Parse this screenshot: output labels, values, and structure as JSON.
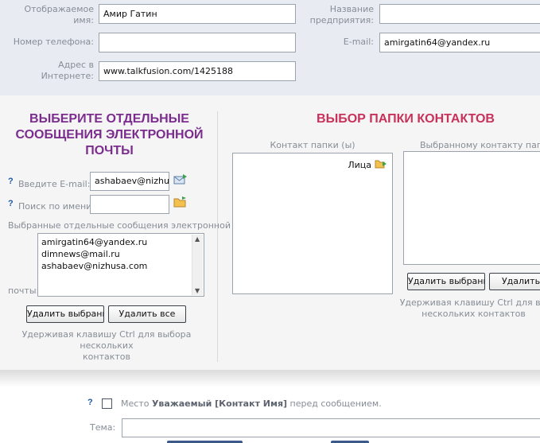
{
  "form": {
    "display_name_label_1": "Отображаемое",
    "display_name_label_2": "имя:",
    "display_name_value": "Амир Гатин",
    "company_label_1": "Название",
    "company_label_2": "предприятия:",
    "company_value": "",
    "phone_label": "Номер телефона:",
    "phone_value": "",
    "email_label": "E-mail:",
    "email_value": "amirgatin64@yandex.ru",
    "web_label_1": "Адрес в",
    "web_label_2": "Интернете:",
    "web_value": "www.talkfusion.com/1425188"
  },
  "left_panel": {
    "title_1": "ВЫБЕРИТЕ ОТДЕЛЬНЫЕ",
    "title_2": "СООБЩЕНИЯ ЭЛЕКТРОННОЙ",
    "title_3": "ПОЧТЫ",
    "title_color": "#7b2d8e",
    "help": "?",
    "enter_email_label": "Введите E-mail:",
    "enter_email_value": "ashabaev@nizhus",
    "search_name_label": "Поиск по имени:",
    "search_name_value": "",
    "selected_label_1": "Выбранные отдельные сообщения электронной",
    "selected_label_2": "почты:",
    "selected_emails": [
      "amirgatin64@yandex.ru",
      "dimnews@mail.ru",
      "ashabaev@nizhusa.com"
    ],
    "delete_selected": "Удалить выбранное",
    "delete_all": "Удалить все",
    "hint_1": "Удерживая клавишу Ctrl для выбора нескольких",
    "hint_2": "контактов"
  },
  "right_panel": {
    "title": "ВЫБОР ПАПКИ КОНТАКТОВ",
    "title_color": "#c8325a",
    "folders_label": "Контакт папки (ы)",
    "folders": [
      "Лица"
    ],
    "selected_label": "Выбранному контакту папки (",
    "delete_selected": "Удалить выбранное",
    "delete_all": "Удалить",
    "hint_1": "Удерживая клавишу Ctrl для вы",
    "hint_2": "нескольких контактов"
  },
  "bottom": {
    "help": "?",
    "salutation_prefix": "Место ",
    "salutation_bold": "Уважаемый [Контакт Имя]",
    "salutation_suffix": " перед сообщением.",
    "subject_label": "Тема:",
    "subject_value": ""
  },
  "icons": {
    "add_email": "add-email-icon",
    "browse": "folder-search-icon",
    "folder_add": "folder-arrow-icon"
  }
}
